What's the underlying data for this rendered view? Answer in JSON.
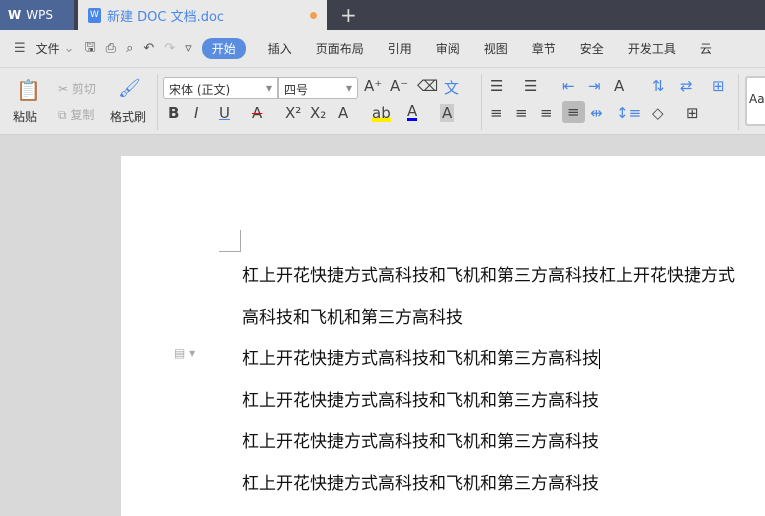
{
  "tabs": {
    "app": "WPS",
    "document": "新建 DOC 文档.doc"
  },
  "menu": {
    "file": "文件",
    "items": [
      "开始",
      "插入",
      "页面布局",
      "引用",
      "审阅",
      "视图",
      "章节",
      "安全",
      "开发工具",
      "云"
    ]
  },
  "toolbar": {
    "paste": "粘贴",
    "cut": "剪切",
    "copy": "复制",
    "format_painter": "格式刷",
    "font_name": "宋体 (正文)",
    "font_size": "四号",
    "style_preview": "AaBb"
  },
  "document": {
    "lines": [
      "杠上开花快捷方式高科技和飞机和第三方高科技杠上开花快捷方式",
      "高科技和飞机和第三方高科技",
      "杠上开花快捷方式高科技和飞机和第三方高科技",
      "杠上开花快捷方式高科技和飞机和第三方高科技",
      "杠上开花快捷方式高科技和飞机和第三方高科技",
      "杠上开花快捷方式高科技和飞机和第三方高科技"
    ]
  }
}
